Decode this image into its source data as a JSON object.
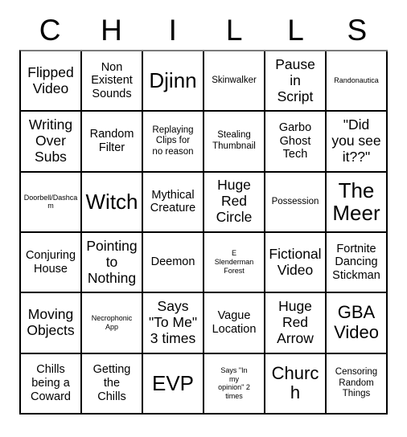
{
  "card": {
    "title_letters": [
      "C",
      "H",
      "I",
      "L",
      "L",
      "S"
    ],
    "rows": 6,
    "columns": 6,
    "cells": [
      {
        "text": "Flipped\nVideo",
        "size": "l"
      },
      {
        "text": "Non\nExistent\nSounds",
        "size": "m"
      },
      {
        "text": "Djinn",
        "size": "xxl"
      },
      {
        "text": "Skinwalker",
        "size": "s"
      },
      {
        "text": "Pause\nin\nScript",
        "size": "l"
      },
      {
        "text": "Randonautica",
        "size": "xs"
      },
      {
        "text": "Writing\nOver\nSubs",
        "size": "l"
      },
      {
        "text": "Random\nFilter",
        "size": "m"
      },
      {
        "text": "Replaying\nClips for\nno reason",
        "size": "s"
      },
      {
        "text": "Stealing\nThumbnail",
        "size": "s"
      },
      {
        "text": "Garbo\nGhost\nTech",
        "size": "m"
      },
      {
        "text": "\"Did\nyou see\nit??\"",
        "size": "l"
      },
      {
        "text": "Doorbell/Dashcam",
        "size": "xs"
      },
      {
        "text": "Witch",
        "size": "xxl"
      },
      {
        "text": "Mythical\nCreature",
        "size": "m"
      },
      {
        "text": "Huge\nRed\nCircle",
        "size": "l"
      },
      {
        "text": "Possession",
        "size": "s"
      },
      {
        "text": "The\nMeer",
        "size": "xxl"
      },
      {
        "text": "Conjuring\nHouse",
        "size": "m"
      },
      {
        "text": "Pointing\nto\nNothing",
        "size": "l"
      },
      {
        "text": "Deemon",
        "size": "m"
      },
      {
        "text": "E\nSlenderman\nForest",
        "size": "xs"
      },
      {
        "text": "Fictional\nVideo",
        "size": "l"
      },
      {
        "text": "Fortnite\nDancing\nStickman",
        "size": "m"
      },
      {
        "text": "Moving\nObjects",
        "size": "l"
      },
      {
        "text": "Necrophonic\nApp",
        "size": "xs"
      },
      {
        "text": "Says\n\"To Me\"\n3 times",
        "size": "l"
      },
      {
        "text": "Vague\nLocation",
        "size": "m"
      },
      {
        "text": "Huge\nRed\nArrow",
        "size": "l"
      },
      {
        "text": "GBA\nVideo",
        "size": "xl"
      },
      {
        "text": "Chills\nbeing a\nCoward",
        "size": "m"
      },
      {
        "text": "Getting\nthe\nChills",
        "size": "m"
      },
      {
        "text": "EVP",
        "size": "xxl"
      },
      {
        "text": "Says \"In\nmy\nopinion\" 2\ntimes",
        "size": "xs"
      },
      {
        "text": "Church",
        "size": "xl"
      },
      {
        "text": "Censoring\nRandom\nThings",
        "size": "s"
      }
    ]
  },
  "colors": {
    "background": "#ffffff",
    "text": "#000000",
    "grid_line": "#000000",
    "grid_line_top": "#7a7a7a"
  }
}
